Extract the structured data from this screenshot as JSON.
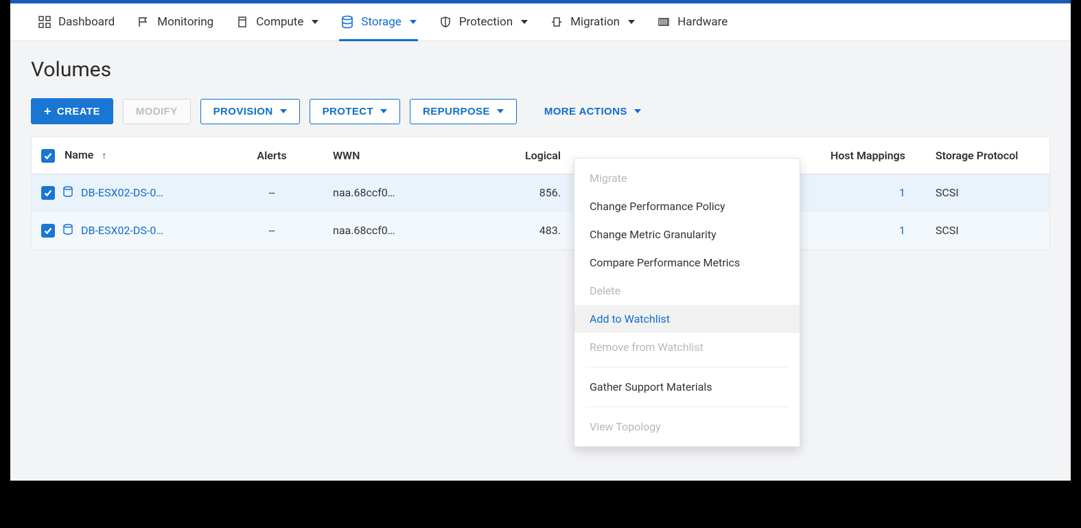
{
  "nav": {
    "dashboard": "Dashboard",
    "monitoring": "Monitoring",
    "compute": "Compute",
    "storage": "Storage",
    "protection": "Protection",
    "migration": "Migration",
    "hardware": "Hardware"
  },
  "page": {
    "title": "Volumes"
  },
  "toolbar": {
    "create": "CREATE",
    "modify": "MODIFY",
    "provision": "PROVISION",
    "protect": "PROTECT",
    "repurpose": "REPURPOSE",
    "more_actions": "MORE ACTIONS"
  },
  "columns": {
    "name": "Name",
    "alerts": "Alerts",
    "wwn": "WWN",
    "logical": "Logical",
    "host_mappings": "Host Mappings",
    "storage_protocol": "Storage Protocol"
  },
  "rows": [
    {
      "name": "DB-ESX02-DS-0…",
      "alerts": "--",
      "wwn": "naa.68ccf0…",
      "logical": "856.",
      "host_mappings": "1",
      "protocol": "SCSI"
    },
    {
      "name": "DB-ESX02-DS-0…",
      "alerts": "--",
      "wwn": "naa.68ccf0…",
      "logical": "483.",
      "host_mappings": "1",
      "protocol": "SCSI"
    }
  ],
  "dropdown": {
    "migrate": "Migrate",
    "change_perf_policy": "Change Performance Policy",
    "change_metric_gran": "Change Metric Granularity",
    "compare_perf": "Compare Performance Metrics",
    "delete": "Delete",
    "add_watchlist": "Add to Watchlist",
    "remove_watchlist": "Remove from Watchlist",
    "gather_support": "Gather Support Materials",
    "view_topology": "View Topology"
  }
}
